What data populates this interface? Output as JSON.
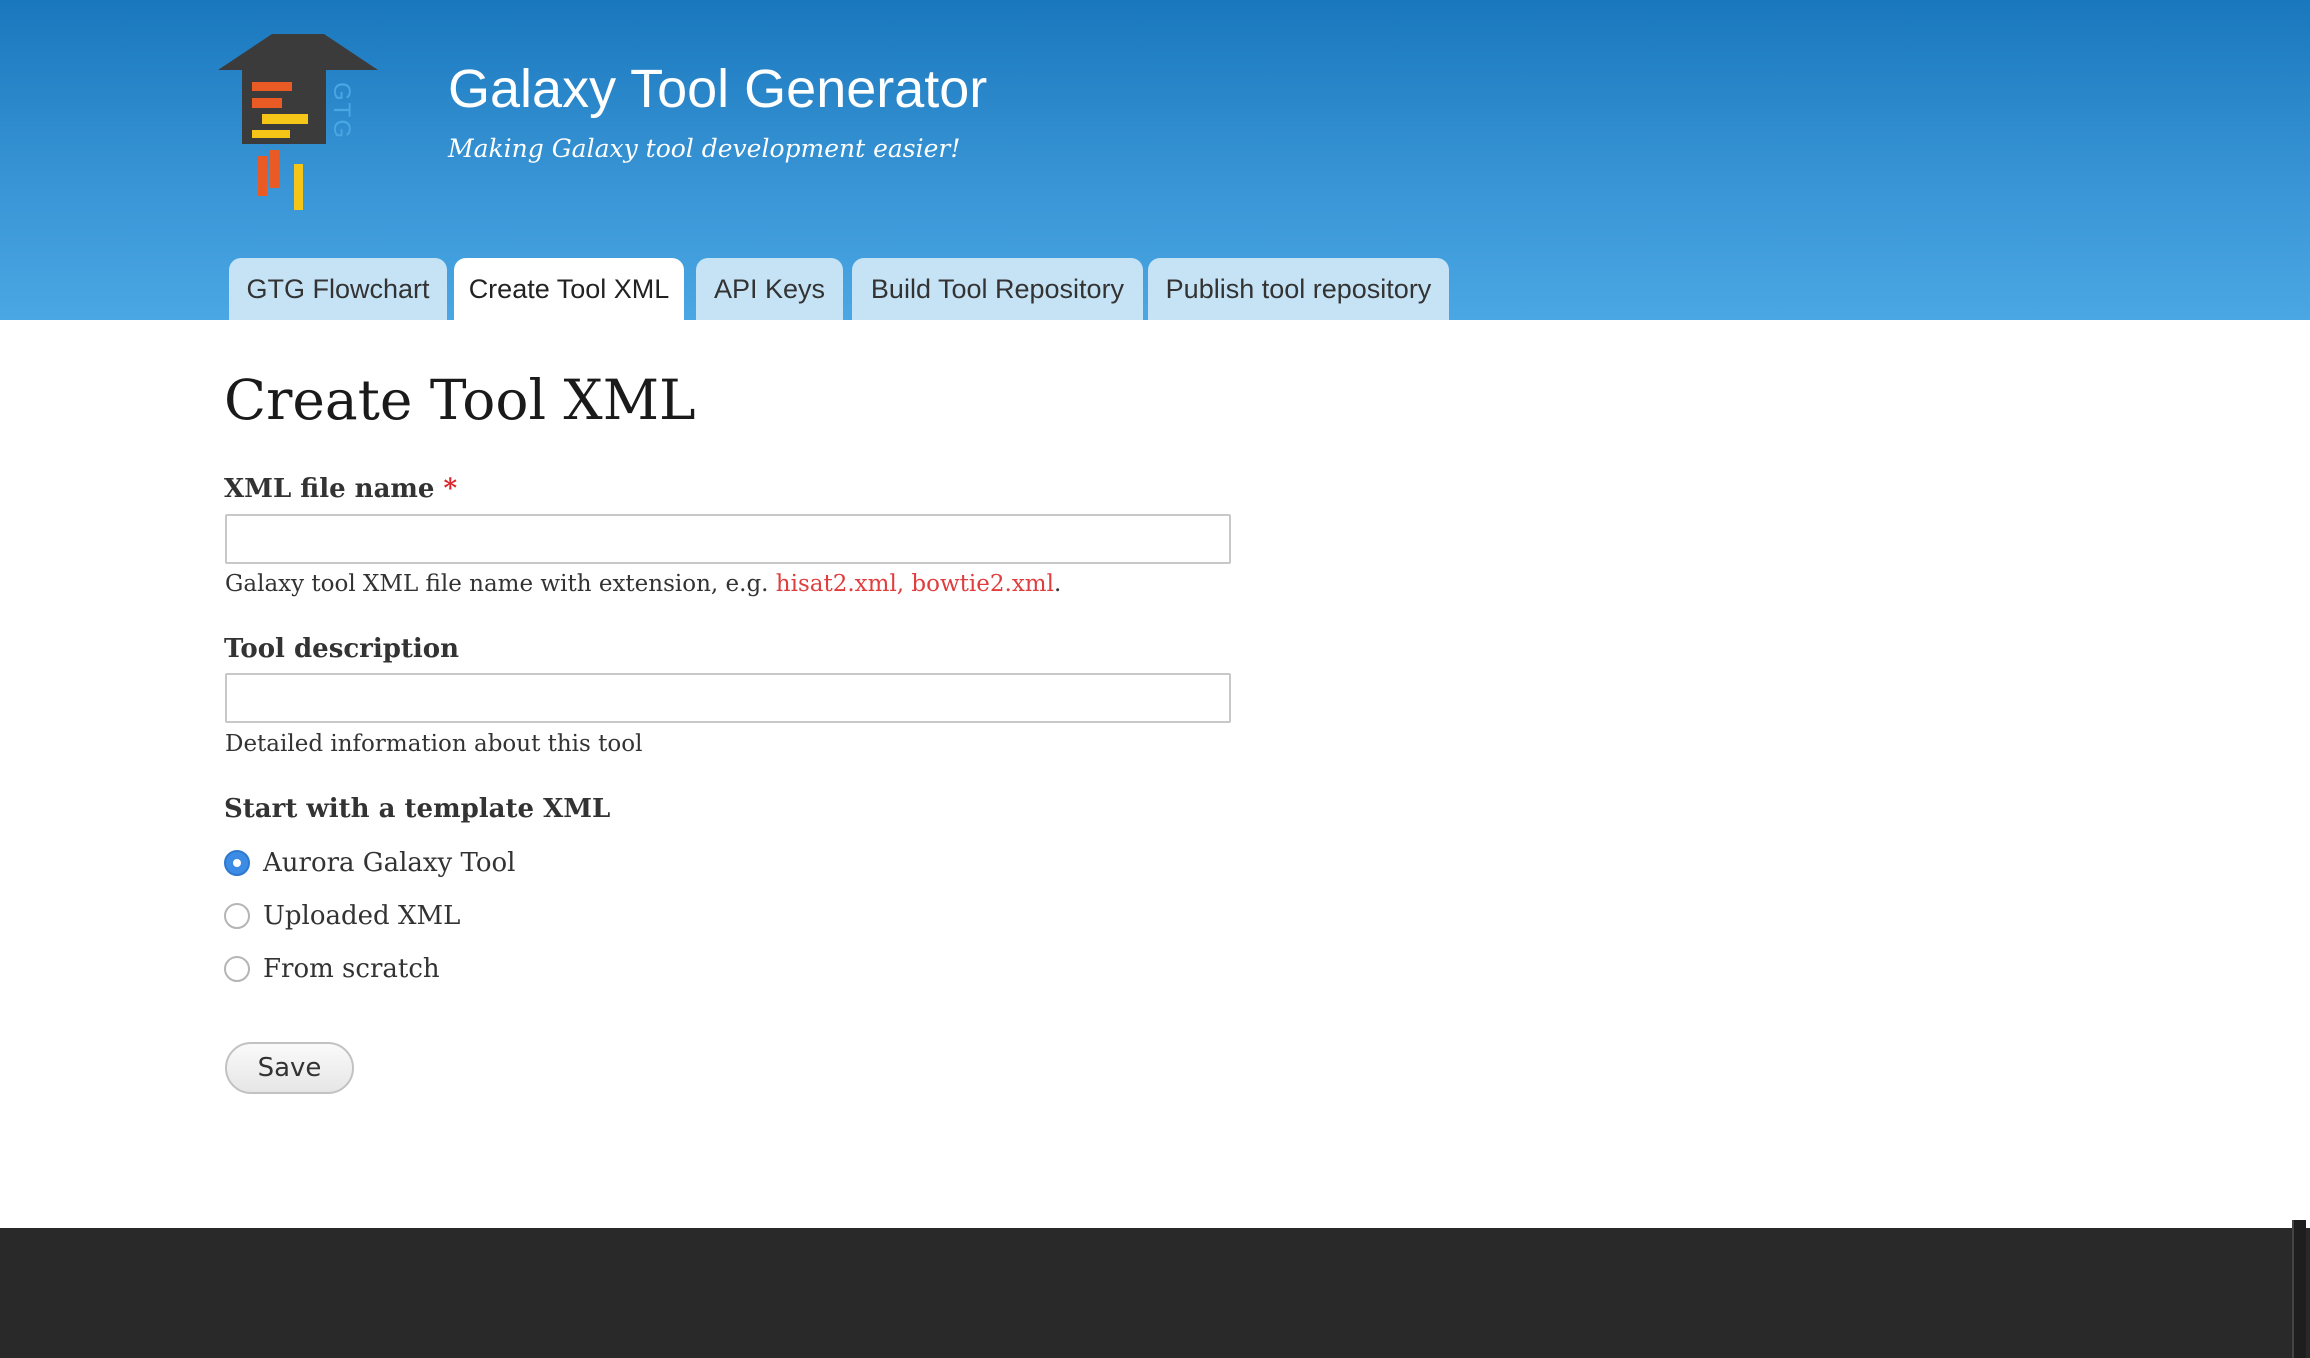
{
  "header": {
    "site_name": "Galaxy Tool Generator",
    "slogan": "Making Galaxy tool development easier!",
    "logo_text": "GTG"
  },
  "tabs": [
    {
      "label": "GTG Flowchart",
      "active": false
    },
    {
      "label": "Create Tool XML",
      "active": true
    },
    {
      "label": "API Keys",
      "active": false
    },
    {
      "label": "Build Tool Repository",
      "active": false
    },
    {
      "label": "Publish tool repository",
      "active": false
    }
  ],
  "main": {
    "page_title": "Create Tool XML",
    "xml_file_name": {
      "label": "XML file name",
      "required_marker": "*",
      "value": "",
      "help_prefix": "Galaxy tool XML file name with extension, e.g. ",
      "help_example": "hisat2.xml, bowtie2.xml",
      "help_suffix": "."
    },
    "tool_description": {
      "label": "Tool description",
      "value": "",
      "help": "Detailed information about this tool"
    },
    "template": {
      "label": "Start with a template XML",
      "options": [
        {
          "label": "Aurora Galaxy Tool",
          "checked": true
        },
        {
          "label": "Uploaded XML",
          "checked": false
        },
        {
          "label": "From scratch",
          "checked": false
        }
      ]
    },
    "save_label": "Save"
  },
  "colors": {
    "header_top": "#1977bd",
    "header_bottom": "#4aa7e3",
    "tab_inactive": "#c5e3f5",
    "required_star": "#d9262c",
    "example_text": "#e03e3e",
    "radio_checked": "#3c8ce6",
    "footer": "#292929"
  }
}
